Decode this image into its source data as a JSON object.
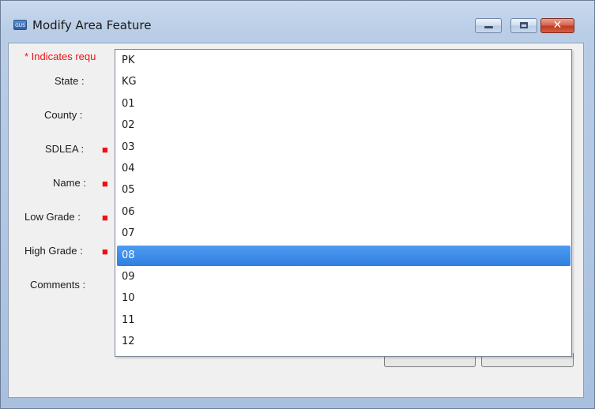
{
  "window": {
    "title": "Modify Area Feature",
    "icon_label": "GUS",
    "icon": "app-icon",
    "controls": [
      "minimize-icon",
      "maximize-icon",
      "close-icon"
    ],
    "close_glyph": "✕"
  },
  "form": {
    "required_note": "* Indicates requ",
    "labels": {
      "state": "State :",
      "county": "County :",
      "sdlea": "SDLEA :",
      "name": "Name :",
      "low_grade": "Low Grade :",
      "high_grade": "High Grade :",
      "comments": "Comments :"
    },
    "required_marker": "■"
  },
  "dropdown": {
    "options": [
      "PK",
      "KG",
      "01",
      "02",
      "03",
      "04",
      "05",
      "06",
      "07",
      "08",
      "09",
      "10",
      "11",
      "12"
    ],
    "selected": "08",
    "selected_color": "#3388e8"
  }
}
